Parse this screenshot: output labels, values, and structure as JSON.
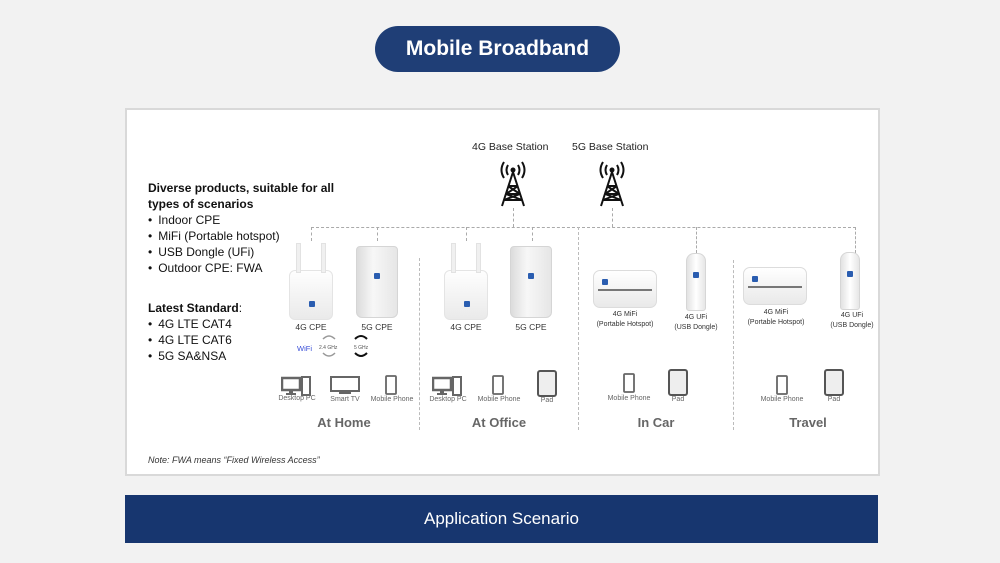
{
  "header": {
    "title": "Mobile Broadband"
  },
  "intro": {
    "heading": "Diverse products, suitable for all types of scenarios",
    "products": [
      "Indoor CPE",
      "MiFi (Portable hotspot)",
      "USB Dongle (UFi)",
      "Outdoor CPE: FWA"
    ],
    "standard_heading": "Latest Standard",
    "standard_suffix": ":",
    "standards": [
      "4G LTE CAT4",
      "4G LTE CAT6",
      "5G SA&NSA"
    ]
  },
  "base_stations": [
    {
      "label": "4G Base Station",
      "icon": "cell-tower-icon"
    },
    {
      "label": "5G Base Station",
      "icon": "cell-tower-icon"
    }
  ],
  "wifi": {
    "label": "WiFi",
    "band1": "2.4 GHz",
    "band2": "5 GHz",
    "accent": "#3a4fd8"
  },
  "scenarios": [
    {
      "name": "At Home",
      "products": [
        "4G CPE",
        "5G CPE"
      ],
      "devices": [
        "Desktop PC",
        "Smart TV",
        "Mobile Phone"
      ]
    },
    {
      "name": "At Office",
      "products": [
        "4G CPE",
        "5G CPE"
      ],
      "devices": [
        "Desktop PC",
        "Mobile Phone",
        "Pad"
      ]
    },
    {
      "name": "In Car",
      "products": [
        {
          "line1": "4G MiFi",
          "line2": "(Portable Hotspot)"
        },
        {
          "line1": "4G UFi",
          "line2": "(USB Dongle)"
        }
      ],
      "devices": [
        "Mobile Phone",
        "Pad"
      ]
    },
    {
      "name": "Travel",
      "products": [
        {
          "line1": "4G MiFi",
          "line2": "(Portable Hotspot)"
        },
        {
          "line1": "4G UFi",
          "line2": "(USB Dongle)"
        }
      ],
      "devices": [
        "Mobile Phone",
        "Pad"
      ]
    }
  ],
  "note": "Note: FWA means “Fixed Wireless Access”",
  "footer": {
    "label": "Application Scenario"
  },
  "colors": {
    "brand_navy": "#1f3e76",
    "footer_navy": "#17366f",
    "scenario_gray": "#666666"
  }
}
